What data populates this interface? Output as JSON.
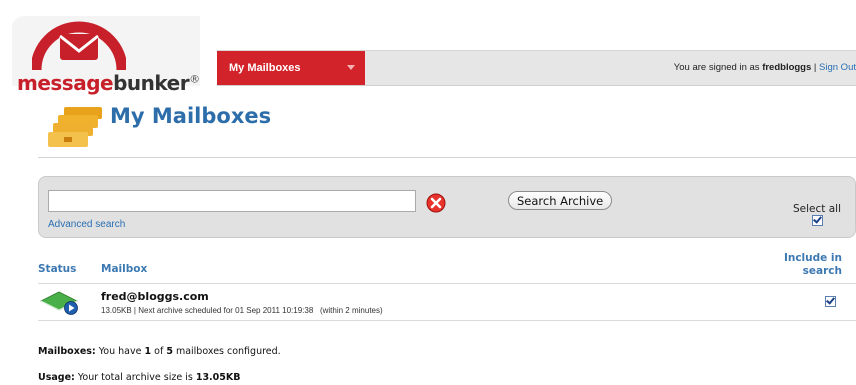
{
  "brand": {
    "logo_part1": "message",
    "logo_part2": "bunker",
    "logo_mark": "®"
  },
  "nav": {
    "active_tab": "My Mailboxes"
  },
  "user": {
    "signed_in_prefix": "You are signed in as ",
    "username": "fredbloggs",
    "separator": " | ",
    "sign_out": "Sign Out"
  },
  "page": {
    "title": "My Mailboxes"
  },
  "search": {
    "input_value": "",
    "advanced_link": "Advanced search",
    "button_label": "Search Archive",
    "select_all_label": "Select all"
  },
  "table": {
    "columns": {
      "status": "Status",
      "mailbox": "Mailbox",
      "include": "Include in search"
    },
    "rows": [
      {
        "mailbox": "fred@bloggs.com",
        "detail": "13.05KB | Next archive scheduled for 01 Sep 2011 10:19:38   (within 2 minutes)",
        "include": true
      }
    ]
  },
  "summary": {
    "mailboxes_label": "Mailboxes:",
    "mailboxes_pre": " You have ",
    "configured": "1",
    "mailboxes_mid": " of ",
    "total": "5",
    "mailboxes_post": " mailboxes configured.",
    "usage_label": "Usage:",
    "usage_pre": " Your total archive size is ",
    "usage_value": "13.05KB"
  },
  "colors": {
    "brand_red": "#d2232a",
    "link_blue": "#2a6fb3",
    "heading_blue": "#2d6eaa"
  }
}
